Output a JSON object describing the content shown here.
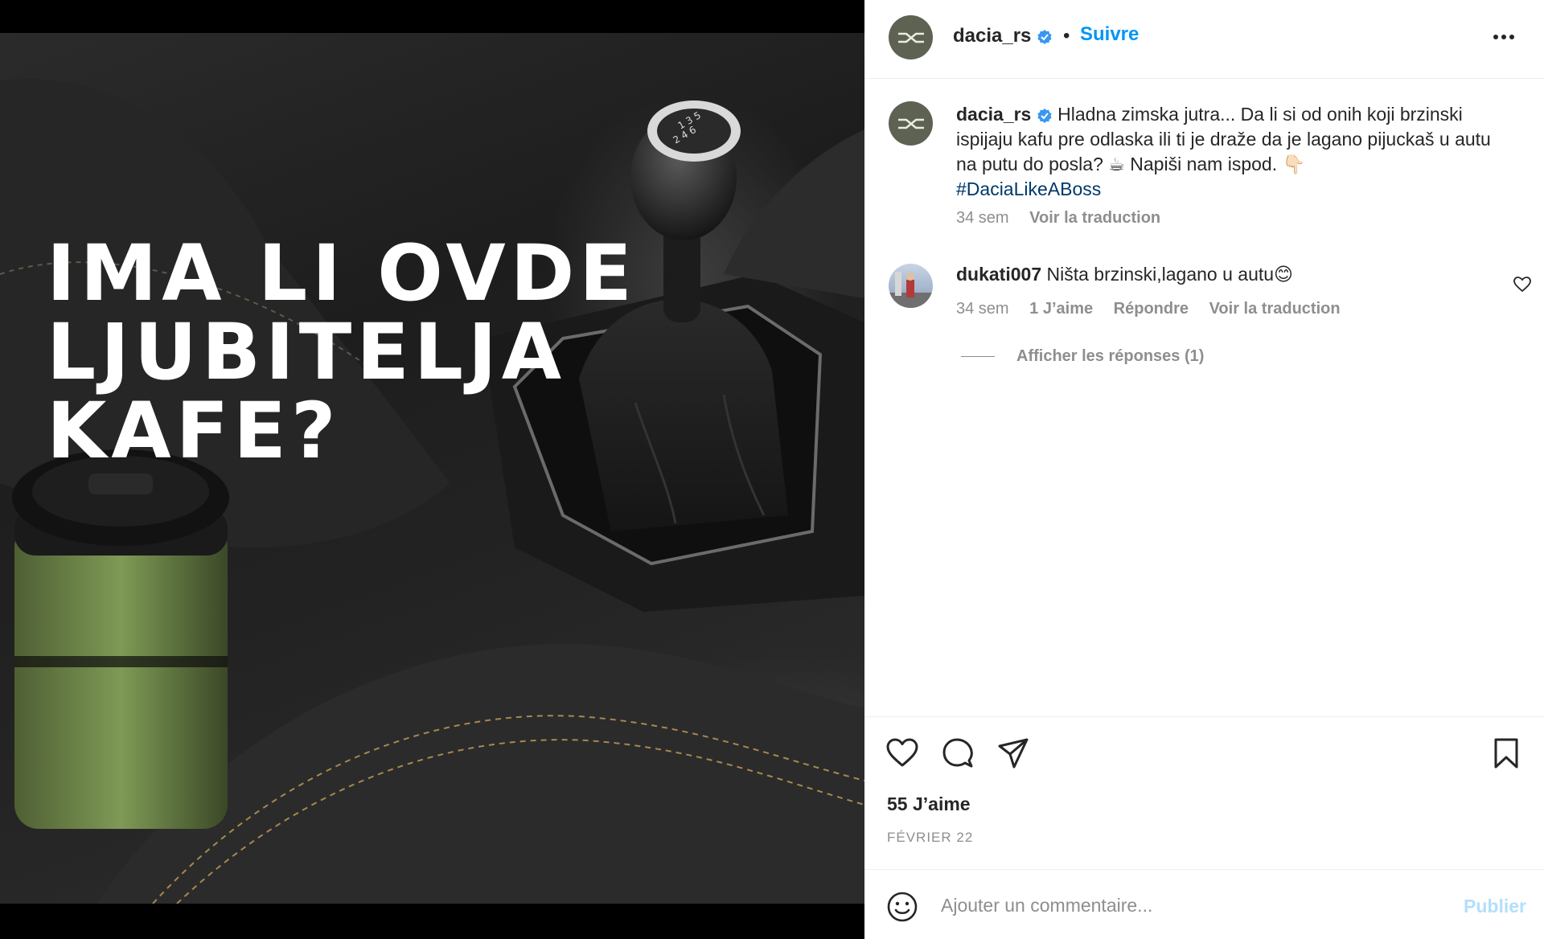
{
  "post": {
    "headline_lines": [
      "IMA LI OVDE",
      "LJUBITELJA",
      "KAFE?"
    ],
    "gear_pattern": [
      "1 3 5",
      "2 4 6"
    ]
  },
  "header": {
    "username": "dacia_rs",
    "separator": "•",
    "follow_label": "Suivre",
    "verified_icon": "verified-badge-icon",
    "more_icon": "more-options-icon"
  },
  "caption": {
    "username": "dacia_rs",
    "text": "Hladna zimska jutra... Da li si od onih koji brzinski ispijaju kafu pre odlaska ili ti je draže da je lagano pijuckaš u autu na putu do posla? ☕ Napiši nam ispod. 👇🏻",
    "hashtag": "#DaciaLikeABoss",
    "time": "34 sem",
    "translate_label": "Voir la traduction"
  },
  "comments": [
    {
      "username": "dukati007",
      "text": "Ništa brzinski,lagano u autu😊",
      "time": "34 sem",
      "likes": "1 J’aime",
      "reply_label": "Répondre",
      "translate_label": "Voir la traduction",
      "show_replies": "Afficher les réponses (1)"
    }
  ],
  "actions": {
    "likes_text": "55 J’aime",
    "date": "FÉVRIER 22",
    "icons": [
      "heart-icon",
      "comment-icon",
      "share-icon",
      "bookmark-icon"
    ]
  },
  "add_comment": {
    "placeholder": "Ajouter un commentaire...",
    "publish_label": "Publier"
  },
  "colors": {
    "accent": "#0095f6",
    "hashtag": "#00376b",
    "muted": "#8e8e8e",
    "publish_disabled": "#b2dffc",
    "avatar_bg": "#5e6252"
  }
}
